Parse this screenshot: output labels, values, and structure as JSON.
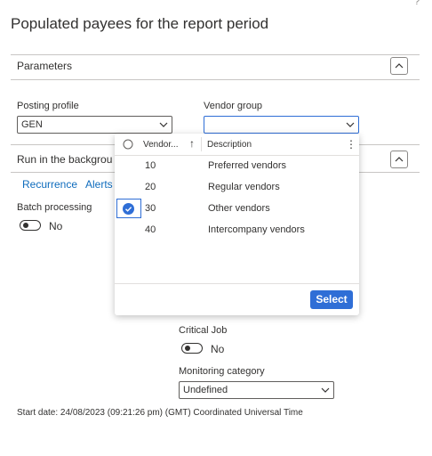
{
  "page": {
    "title": "Populated payees for the report period",
    "help_glyph": "?"
  },
  "parameters": {
    "section_label": "Parameters",
    "posting_profile": {
      "label": "Posting profile",
      "value": "GEN"
    },
    "vendor_group": {
      "label": "Vendor group",
      "value": ""
    }
  },
  "run_background": {
    "section_label": "Run in the backgrou",
    "tabs": [
      "Recurrence",
      "Alerts"
    ],
    "batch_processing": {
      "label": "Batch processing",
      "state": "No"
    },
    "critical_job": {
      "label": "Critical Job",
      "state": "No"
    },
    "monitoring_category": {
      "label": "Monitoring category",
      "value": "Undefined"
    },
    "start_date": "Start date: 24/08/2023 (09:21:26 pm) (GMT) Coordinated Universal Time"
  },
  "lookup": {
    "columns": {
      "vendor": "Vendor...",
      "sort_glyph": "↑",
      "description": "Description",
      "more_glyph": "⋮"
    },
    "rows": [
      {
        "code": "10",
        "description": "Preferred vendors",
        "selected": false
      },
      {
        "code": "20",
        "description": "Regular vendors",
        "selected": false
      },
      {
        "code": "30",
        "description": "Other vendors",
        "selected": true
      },
      {
        "code": "40",
        "description": "Intercompany vendors",
        "selected": false
      }
    ],
    "select_label": "Select"
  },
  "colors": {
    "accent": "#2f6ed6",
    "link": "#0f6cbd",
    "border": "#c8c6c4"
  },
  "icons": [
    "chevron-up-icon",
    "chevron-down-icon",
    "radio-icon",
    "check-circle-icon",
    "sort-asc-icon",
    "more-vertical-icon"
  ]
}
